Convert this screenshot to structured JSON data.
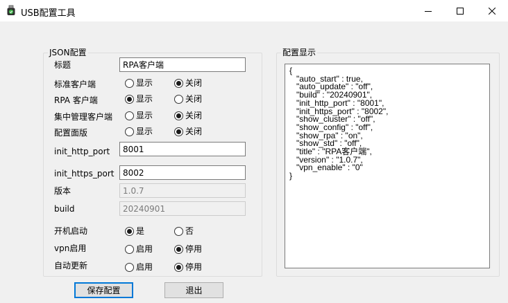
{
  "window": {
    "title": "USB配置工具",
    "icon": "usb-drive-icon",
    "controls": [
      "minimize-icon",
      "maximize-icon",
      "close-icon"
    ]
  },
  "json_group": {
    "legend": "JSON配置",
    "title_label": "标题",
    "title_value": "RPA客户端",
    "std_client": {
      "label": "标准客户端",
      "options": [
        "显示",
        "关闭"
      ],
      "selected": "关闭"
    },
    "rpa_client": {
      "label": "RPA 客户端",
      "options": [
        "显示",
        "关闭"
      ],
      "selected": "显示"
    },
    "cluster_client": {
      "label": "集中管理客户端",
      "options": [
        "显示",
        "关闭"
      ],
      "selected": "关闭"
    },
    "config_panel": {
      "label": "配置面版",
      "options": [
        "显示",
        "关闭"
      ],
      "selected": "关闭"
    },
    "http_port_label": "init_http_port",
    "http_port_value": "8001",
    "https_port_label": "init_https_port",
    "https_port_value": "8002",
    "version_label": "版本",
    "version_value": "1.0.7",
    "build_label": "build",
    "build_value": "20240901",
    "auto_start": {
      "label": "开机启动",
      "options": [
        "是",
        "否"
      ],
      "selected": "是"
    },
    "vpn": {
      "label": "vpn启用",
      "options": [
        "启用",
        "停用"
      ],
      "selected": "停用"
    },
    "auto_update": {
      "label": "自动更新",
      "options": [
        "启用",
        "停用"
      ],
      "selected": "停用"
    }
  },
  "preview_group": {
    "legend": "配置显示",
    "json_text": "{\n   \"auto_start\" : true,\n   \"auto_update\" : \"off\",\n   \"build\" : \"20240901\",\n   \"init_http_port\" : \"8001\",\n   \"init_https_port\" : \"8002\",\n   \"show_cluster\" : \"off\",\n   \"show_config\" : \"off\",\n   \"show_rpa\" : \"on\",\n   \"show_std\" : \"off\",\n   \"title\" : \"RPA客户端\",\n   \"version\" : \"1.0.7\",\n   \"vpn_enable\" : \"0\"\n}"
  },
  "buttons": {
    "save": "保存配置",
    "exit": "退出"
  },
  "colors": {
    "accent": "#0078d7",
    "window_bg": "#f0f0f0"
  }
}
